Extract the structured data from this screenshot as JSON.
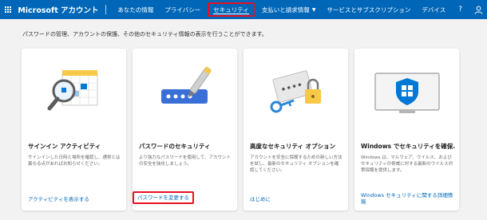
{
  "header": {
    "brand": "Microsoft アカウント",
    "nav": [
      {
        "label": "あなたの情報",
        "active": false
      },
      {
        "label": "プライバシー",
        "active": false
      },
      {
        "label": "セキュリティ",
        "active": true
      },
      {
        "label": "支払いと請求情報",
        "active": false,
        "dropdown": true
      },
      {
        "label": "サービスとサブスクリプション",
        "active": false
      },
      {
        "label": "デバイス",
        "active": false
      }
    ],
    "help": "?",
    "accent": "#0067b8"
  },
  "intro": "パスワードの管理、アカウントの保護、その他のセキュリティ情報の表示を行うことができます。",
  "cards": [
    {
      "title": "サインイン アクティビティ",
      "desc": "サインインした日時と場所を確認し、通常とは異なる点があればお知らせください。",
      "link": "アクティビティを表示する",
      "icon": "calendar-magnifier-icon"
    },
    {
      "title": "パスワードのセキュリティ",
      "desc": "より強力なパスワードを使用して、アカウントの安全を強化しましょう。",
      "link": "パスワードを変更する",
      "icon": "password-pen-icon"
    },
    {
      "title": "高度なセキュリティ オプション",
      "desc": "アカウントを安全に保護するための新しい方法を試し、最新のセキュリティ オプションを確認してください。",
      "link": "はじめに",
      "icon": "key-lock-icon"
    },
    {
      "title": "Windows でセキュリティを確保...",
      "desc": "Windows は、マルウェア、ウイルス、およびセキュリティの脅威に対する最新のウイルス対策保護を提供します。",
      "link": "Windows セキュリティに関する詳細情報",
      "icon": "shield-monitor-icon"
    }
  ]
}
